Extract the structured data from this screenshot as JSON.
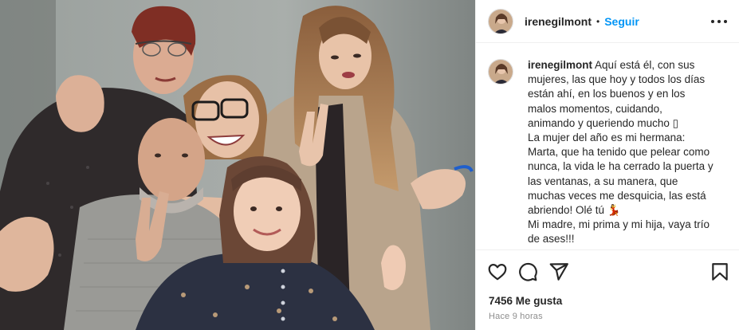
{
  "post": {
    "username": "irenegilmont",
    "separator": "•",
    "follow_label": "Seguir",
    "caption_lines": [
      "Aquí está él, con sus",
      "mujeres, las que hoy y todos los días",
      "están ahí, en los buenos y en los",
      "malos momentos, cuidando,",
      "animando y queriendo mucho ▯",
      "La mujer del año es mi hermana:",
      "Marta, que ha tenido que pelear como",
      "nunca, la vida le ha cerrado la puerta y",
      "las ventanas, a su manera, que",
      "muchas veces me desquicia, las está",
      "abriendo! Olé tú 💃",
      "Mi madre, mi prima y mi hija, vaya trío",
      "de ases!!!"
    ],
    "likes_text": "7456 Me gusta",
    "time_text": "Hace 9 horas"
  },
  "icons": {
    "more": "more-options-icon",
    "like": "heart-icon",
    "comment": "comment-bubble-icon",
    "share": "paper-plane-icon",
    "save": "bookmark-icon"
  },
  "colors": {
    "follow": "#0095f6",
    "text": "#262626",
    "secondary": "#8e8e8e",
    "border": "#efefef"
  }
}
